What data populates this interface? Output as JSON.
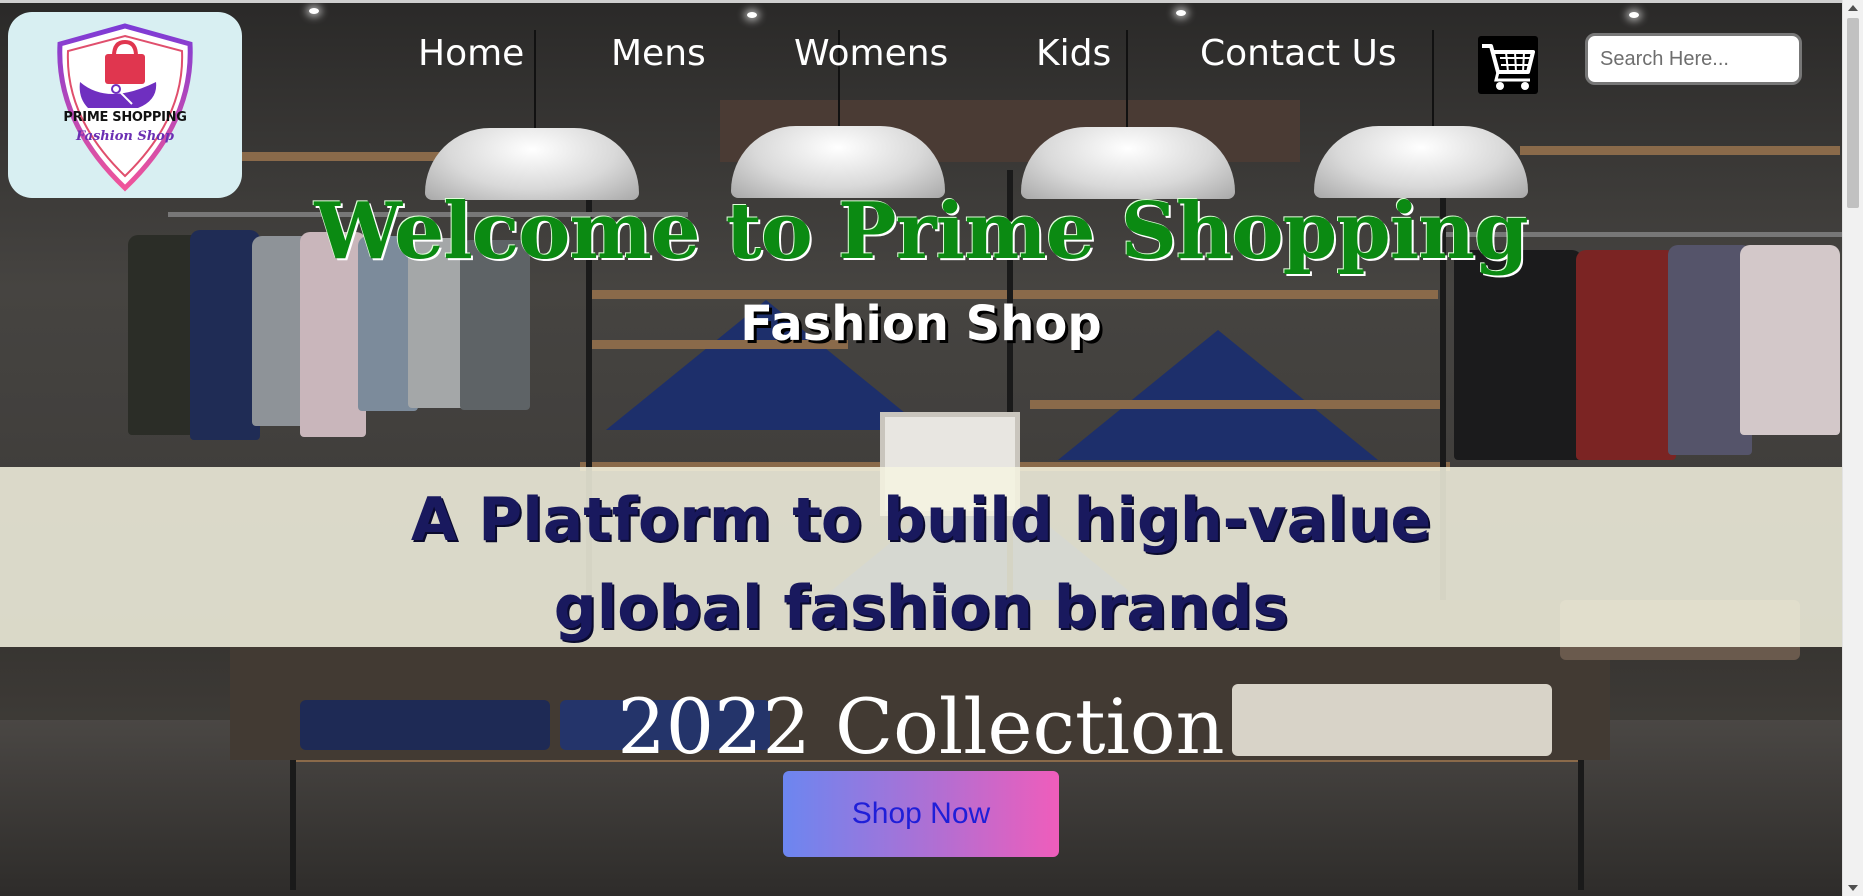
{
  "logo": {
    "line1": "PRIME SHOPPING",
    "line2": "Fashion Shop",
    "icon": "shopping-bag-shield-icon",
    "background": "#d8eff2"
  },
  "nav": {
    "items": [
      {
        "label": "Home"
      },
      {
        "label": "Mens"
      },
      {
        "label": "Womens"
      },
      {
        "label": "Kids"
      },
      {
        "label": "Contact Us"
      }
    ]
  },
  "cart": {
    "icon": "shopping-cart-icon"
  },
  "search": {
    "placeholder": "Search Here...",
    "value": ""
  },
  "hero": {
    "title": "Welcome to Prime Shopping",
    "subtitle": "Fashion Shop",
    "tagline_line1": "A Platform to build high-value",
    "tagline_line2": "global fashion brands",
    "collection": "2022 Collection",
    "cta": "Shop Now"
  },
  "colors": {
    "title": "#0b8a12",
    "tagline": "#19195e",
    "cta_gradient_start": "#6c86f0",
    "cta_gradient_end": "#ef5dbb",
    "cta_text": "#1f1fd8"
  }
}
